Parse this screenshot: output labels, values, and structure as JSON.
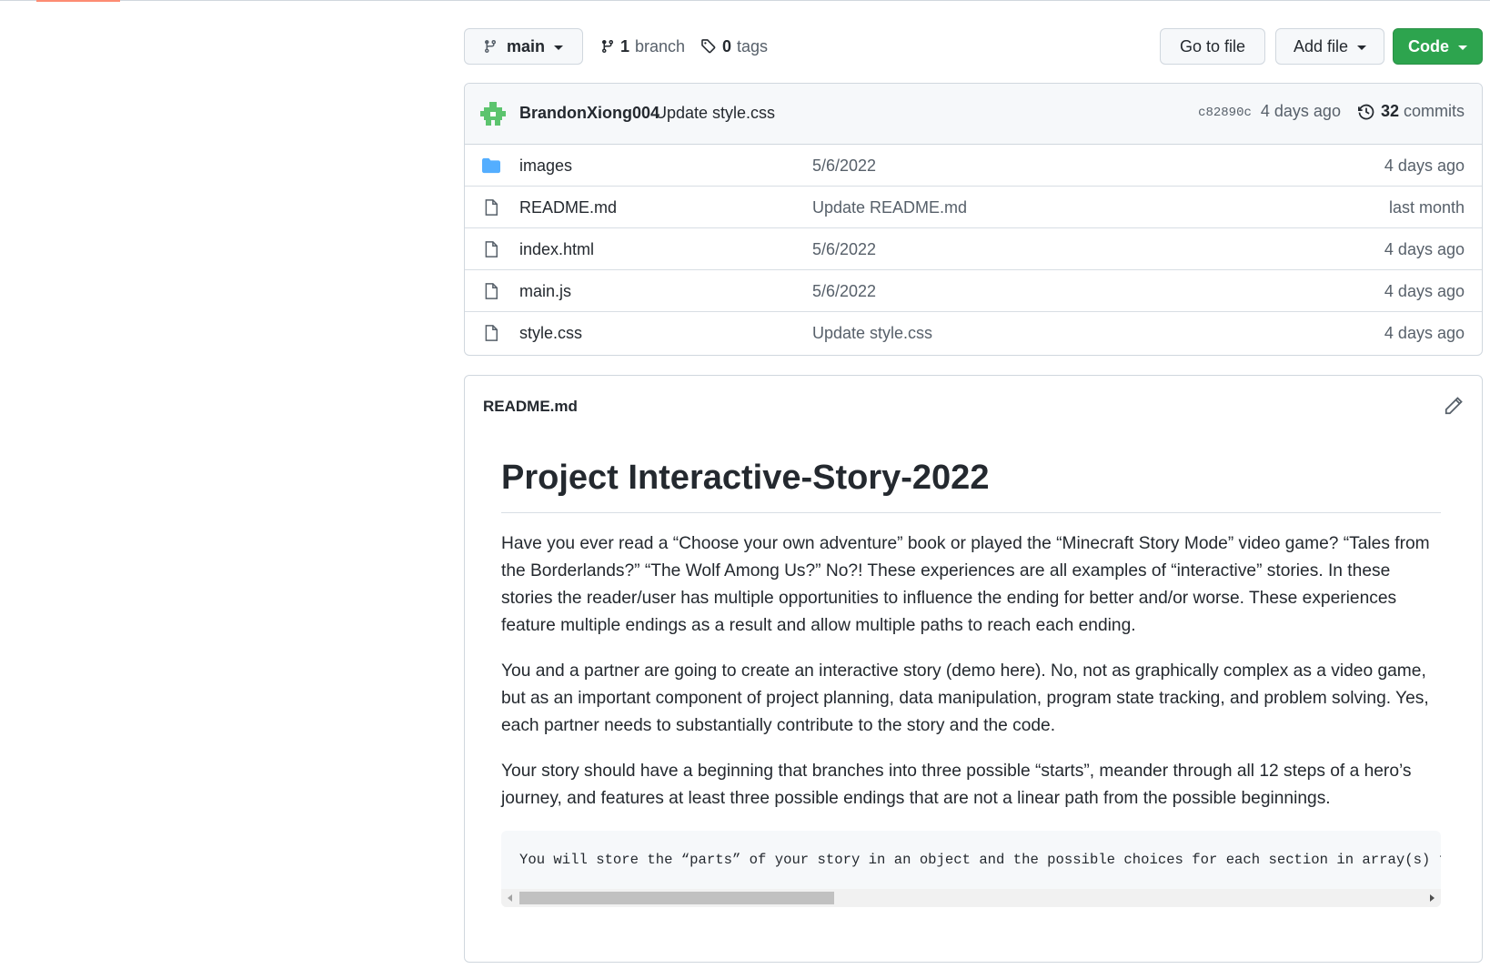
{
  "toolbar": {
    "branch_name": "main",
    "branch_count": "1",
    "branch_label": "branch",
    "tag_count": "0",
    "tag_label": "tags",
    "go_to_file": "Go to file",
    "add_file": "Add file",
    "code": "Code"
  },
  "commit": {
    "author": "BrandonXiong004",
    "message": "Update style.css",
    "sha": "c82890c",
    "age": "4 days ago",
    "commit_count": "32",
    "commit_label": "commits"
  },
  "files": [
    {
      "type": "folder",
      "icon": "folder-icon",
      "name": "images",
      "commit": "5/6/2022",
      "age": "4 days ago"
    },
    {
      "type": "file",
      "icon": "file-icon",
      "name": "README.md",
      "commit": "Update README.md",
      "age": "last month"
    },
    {
      "type": "file",
      "icon": "file-icon",
      "name": "index.html",
      "commit": "5/6/2022",
      "age": "4 days ago"
    },
    {
      "type": "file",
      "icon": "file-icon",
      "name": "main.js",
      "commit": "5/6/2022",
      "age": "4 days ago"
    },
    {
      "type": "file",
      "icon": "file-icon",
      "name": "style.css",
      "commit": "Update style.css",
      "age": "4 days ago"
    }
  ],
  "readme": {
    "filename": "README.md",
    "title": "Project Interactive-Story-2022",
    "paragraphs": [
      "Have you ever read a “Choose your own adventure” book or played the “Minecraft Story Mode” video game? “Tales from the Borderlands?” “The Wolf Among Us?” No?! These experiences are all examples of “interactive” stories. In these stories the reader/user has multiple opportunities to influence the ending for better and/or worse. These experiences feature multiple endings as a result and allow multiple paths to reach each ending.",
      "You and a partner are going to create an interactive story (demo here). No, not as graphically complex as a video game, but as an important component of project planning, data manipulation, program state tracking, and problem solving. Yes, each partner needs to substantially contribute to the story and the code.",
      "Your story should have a beginning that branches into three possible “starts”, meander through all 12 steps of a hero’s journey, and features at least three possible endings that are not a linear path from the possible beginnings."
    ],
    "code": "You will store the “parts” of your story in an object and the possible choices for each section in array(s) t"
  },
  "colors": {
    "accent_green": "#2da44e",
    "folder_blue": "#54aeff",
    "avatar_green": "#5cc46e"
  }
}
